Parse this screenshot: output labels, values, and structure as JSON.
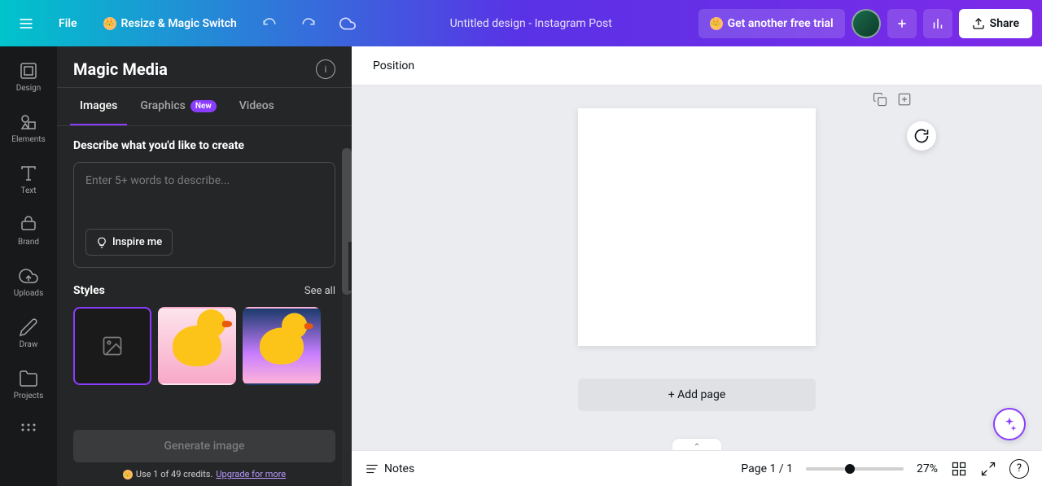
{
  "topbar": {
    "file_label": "File",
    "resize_label": "Resize & Magic Switch",
    "doc_title": "Untitled design - Instagram Post",
    "trial_label": "Get another free trial",
    "share_label": "Share"
  },
  "nav_rail": {
    "items": [
      {
        "label": "Design"
      },
      {
        "label": "Elements"
      },
      {
        "label": "Text"
      },
      {
        "label": "Brand"
      },
      {
        "label": "Uploads"
      },
      {
        "label": "Draw"
      },
      {
        "label": "Projects"
      }
    ]
  },
  "panel": {
    "title": "Magic Media",
    "tabs": {
      "images": "Images",
      "graphics": "Graphics",
      "graphics_badge": "New",
      "videos": "Videos"
    },
    "describe_label": "Describe what you'd like to create",
    "prompt_placeholder": "Enter 5+ words to describe...",
    "inspire_label": "Inspire me",
    "styles_label": "Styles",
    "see_all_label": "See all",
    "generate_label": "Generate image",
    "credits_prefix": "Use 1 of 49 credits.",
    "upgrade_label": "Upgrade for more"
  },
  "canvas": {
    "position_label": "Position",
    "add_page_label": "+ Add page"
  },
  "bottombar": {
    "notes_label": "Notes",
    "page_indicator": "Page 1 / 1",
    "zoom_text": "27%"
  }
}
